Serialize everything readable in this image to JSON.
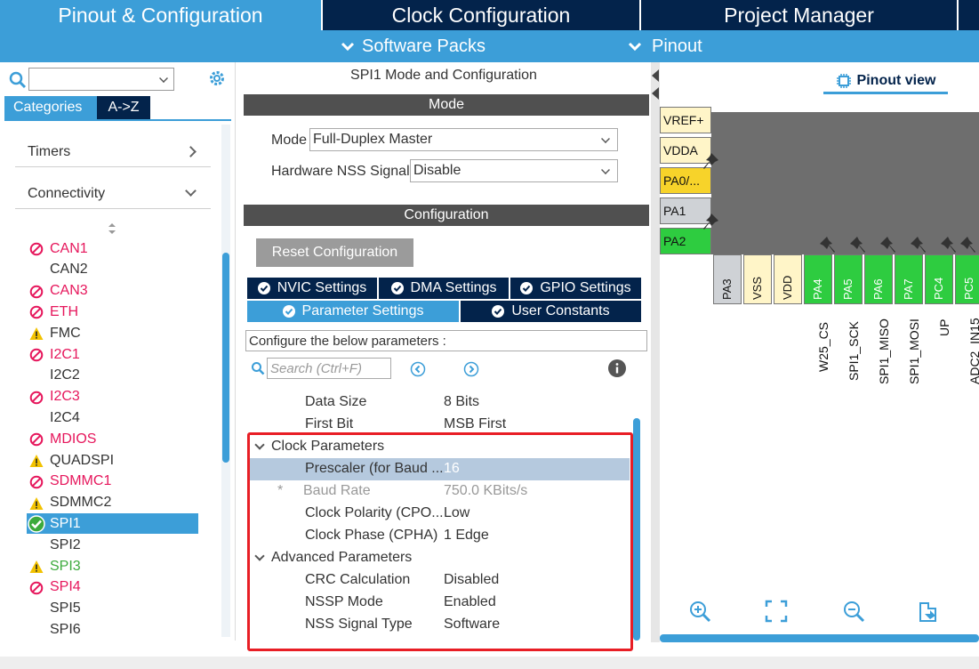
{
  "top_tabs": [
    "Pinout & Configuration",
    "Clock Configuration",
    "Project Manager"
  ],
  "sub_menu": [
    "Software Packs",
    "Pinout"
  ],
  "left": {
    "category_tabs": [
      "Categories",
      "A->Z"
    ],
    "groups": [
      "Timers",
      "Connectivity"
    ],
    "peripherals": [
      {
        "label": "CAN1",
        "state": "disabled"
      },
      {
        "label": "CAN2",
        "state": "none"
      },
      {
        "label": "CAN3",
        "state": "disabled"
      },
      {
        "label": "ETH",
        "state": "disabled"
      },
      {
        "label": "FMC",
        "state": "warning"
      },
      {
        "label": "I2C1",
        "state": "disabled"
      },
      {
        "label": "I2C2",
        "state": "none"
      },
      {
        "label": "I2C3",
        "state": "disabled"
      },
      {
        "label": "I2C4",
        "state": "none"
      },
      {
        "label": "MDIOS",
        "state": "disabled"
      },
      {
        "label": "QUADSPI",
        "state": "warning"
      },
      {
        "label": "SDMMC1",
        "state": "disabled"
      },
      {
        "label": "SDMMC2",
        "state": "warning"
      },
      {
        "label": "SPI1",
        "state": "selected"
      },
      {
        "label": "SPI2",
        "state": "none"
      },
      {
        "label": "SPI3",
        "state": "warning-green"
      },
      {
        "label": "SPI4",
        "state": "disabled"
      },
      {
        "label": "SPI5",
        "state": "none"
      },
      {
        "label": "SPI6",
        "state": "none"
      }
    ]
  },
  "middle": {
    "title": "SPI1 Mode and Configuration",
    "mode_header": "Mode",
    "mode_label": "Mode",
    "mode_value": "Full-Duplex Master",
    "nss_label": "Hardware NSS Signal",
    "nss_value": "Disable",
    "config_header": "Configuration",
    "reset_label": "Reset Configuration",
    "tabs": {
      "nvic": "NVIC Settings",
      "dma": "DMA Settings",
      "gpio": "GPIO Settings",
      "params": "Parameter Settings",
      "user": "User Constants"
    },
    "hint": "Configure the below parameters :",
    "search_placeholder": "Search (Ctrl+F)",
    "params": {
      "data_size": {
        "name": "Data Size",
        "value": "8 Bits"
      },
      "first_bit": {
        "name": "First Bit",
        "value": "MSB First"
      },
      "clock_group": "Clock Parameters",
      "prescaler": {
        "name": "Prescaler (for Baud ...",
        "value": "16"
      },
      "baud_star": "*",
      "baud": {
        "name": "Baud Rate",
        "value": "750.0 KBits/s"
      },
      "cpol": {
        "name": "Clock Polarity (CPO...",
        "value": "Low"
      },
      "cpha": {
        "name": "Clock Phase (CPHA)",
        "value": "1 Edge"
      },
      "adv_group": "Advanced Parameters",
      "crc": {
        "name": "CRC Calculation",
        "value": "Disabled"
      },
      "nssp": {
        "name": "NSSP Mode",
        "value": "Enabled"
      },
      "nss_type": {
        "name": "NSS Signal Type",
        "value": "Software"
      }
    }
  },
  "right": {
    "view_tab": "Pinout view",
    "left_pins": [
      "VREF+",
      "VDDA",
      "PA0/...",
      "PA1",
      "PA2"
    ],
    "bottom_pins": [
      "PA3",
      "VSS",
      "VDD",
      "PA4",
      "PA5",
      "PA6",
      "PA7",
      "PC4",
      "PC5"
    ],
    "signals": [
      "W25_CS",
      "SPI1_SCK",
      "SPI1_MISO",
      "SPI1_MOSI",
      "UP",
      "ADC2_IN15"
    ]
  },
  "colors": {
    "navy": "#03234b",
    "accent": "#3c9ed8",
    "pin_green": "#2ecc40",
    "pin_yellow": "#f7d32a",
    "disabled_red": "#e6175c",
    "warning_yellow": "#f2c200",
    "highlight_red": "#e81e25"
  }
}
